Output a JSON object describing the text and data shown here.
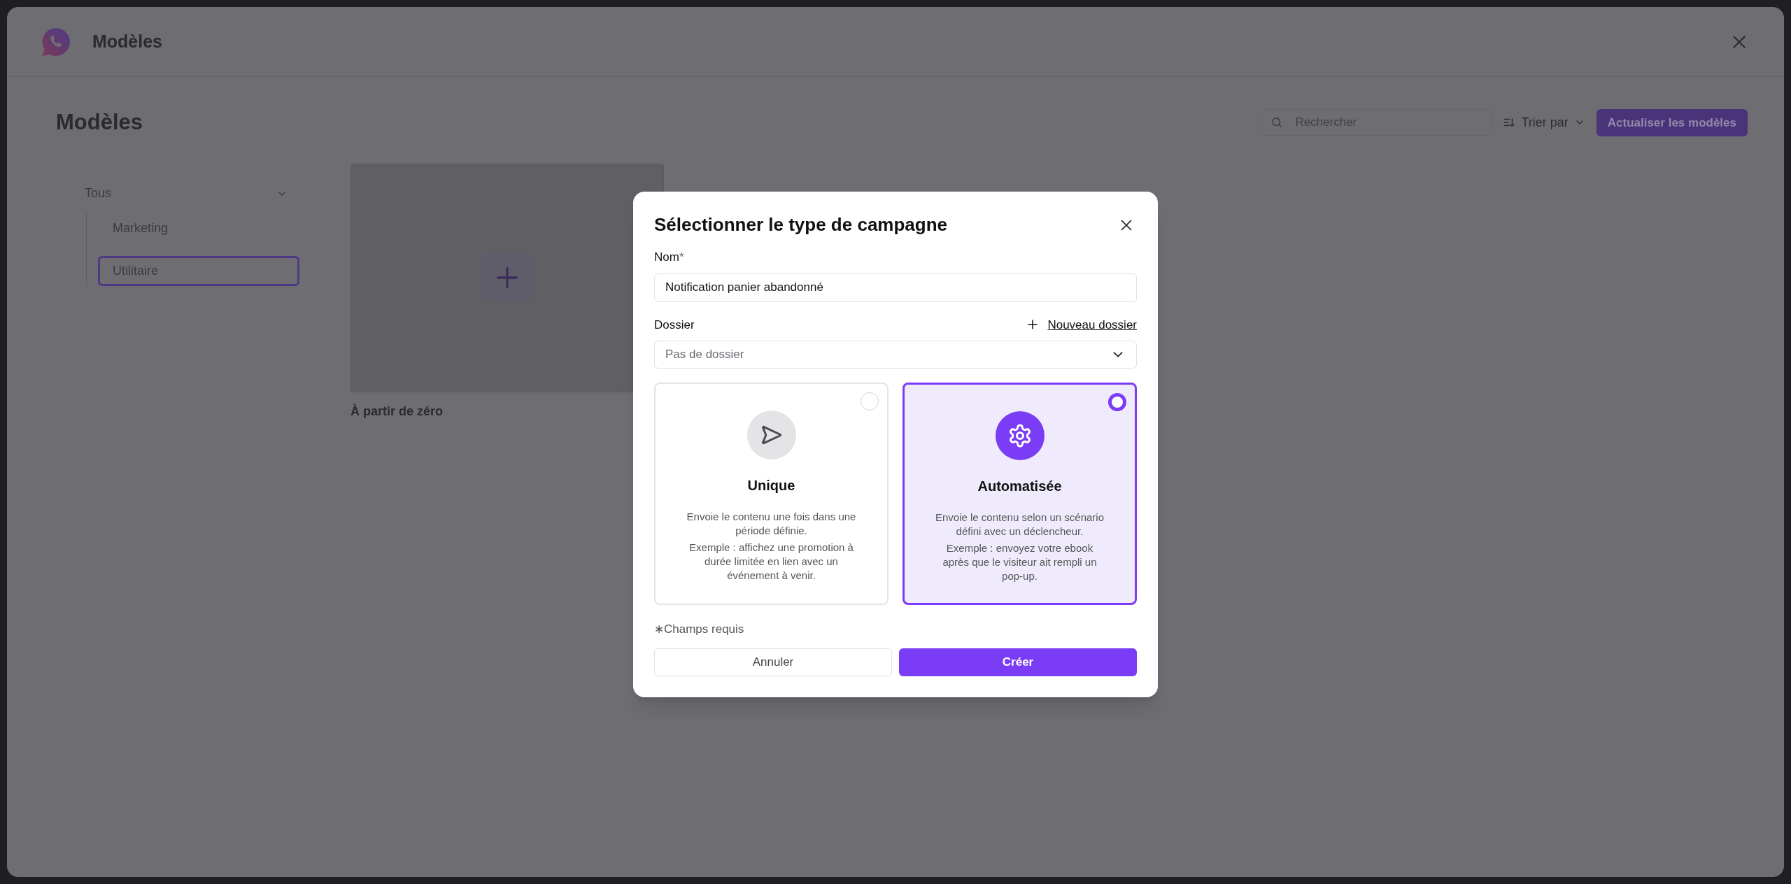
{
  "app_header": {
    "title": "Modèles"
  },
  "page": {
    "title": "Modèles",
    "search": {
      "placeholder": "Rechercher"
    },
    "sort": {
      "label": "Trier par"
    },
    "refresh_button": "Actualiser les modèles"
  },
  "sidebar": {
    "items": [
      {
        "label": "Tous",
        "expanded": true,
        "selected": false,
        "children": [
          {
            "label": "Marketing",
            "selected": false
          },
          {
            "label": "Utilitaire",
            "selected": true
          }
        ]
      }
    ]
  },
  "templates": [
    {
      "title": "À partir de zéro"
    }
  ],
  "dialog": {
    "title": "Sélectionner le type de campagne",
    "name_field": {
      "label": "Nom",
      "required_mark": "*",
      "value": "Notification panier abandonné"
    },
    "folder_field": {
      "label": "Dossier",
      "new_folder_link": "Nouveau dossier",
      "placeholder": "Pas de dossier"
    },
    "campaign_types": [
      {
        "kind": "one_time",
        "title": "Unique",
        "description": "Envoie le contenu une fois dans une période définie.",
        "example": "Exemple : affichez une promotion à durée limitée en lien avec un événement à venir.",
        "selected": false
      },
      {
        "kind": "automated",
        "title": "Automatisée",
        "description": "Envoie le contenu selon un scénario défini avec un déclencheur.",
        "example": "Exemple : envoyez votre ebook après que le visiteur ait rempli un pop-up.",
        "selected": true
      }
    ],
    "required_note": "∗Champs requis",
    "buttons": [
      {
        "kind": "secondary",
        "label": "Annuler"
      },
      {
        "kind": "primary",
        "label": "Créer"
      }
    ]
  }
}
